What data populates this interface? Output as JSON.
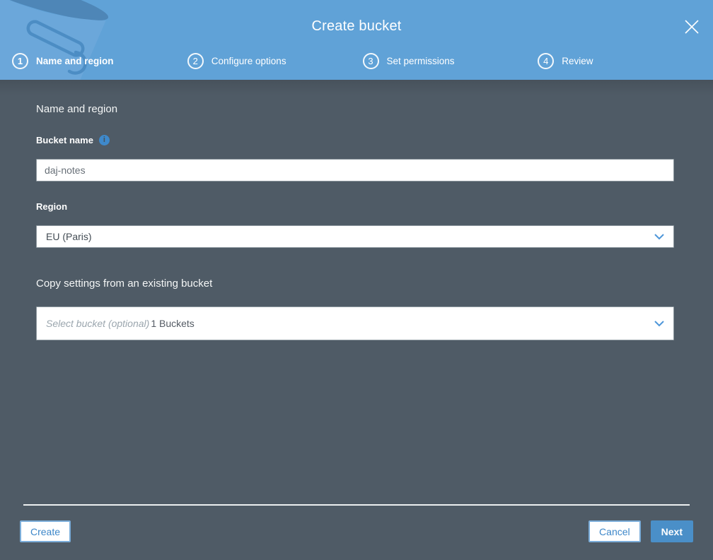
{
  "header": {
    "title": "Create bucket",
    "steps": [
      {
        "number": "1",
        "label": "Name and region"
      },
      {
        "number": "2",
        "label": "Configure options"
      },
      {
        "number": "3",
        "label": "Set permissions"
      },
      {
        "number": "4",
        "label": "Review"
      }
    ]
  },
  "form": {
    "section_heading": "Name and region",
    "bucket_name_label": "Bucket name",
    "bucket_name_value": "daj-notes",
    "region_label": "Region",
    "region_value": "EU (Paris)",
    "copy_heading": "Copy settings from an existing bucket",
    "copy_placeholder": "Select bucket (optional)",
    "copy_count": "1 Buckets",
    "info_icon_glyph": "i"
  },
  "footer": {
    "create": "Create",
    "cancel": "Cancel",
    "next": "Next"
  },
  "icons": {
    "close": "close-icon",
    "info": "info-icon",
    "chevron_down": "chevron-down-icon",
    "watermark": "bucket-icon"
  },
  "colors": {
    "header_blue": "#60a2d7",
    "body_slate": "#4f5b66",
    "accent_blue": "#4a8fc8",
    "link_blue": "#3d87c9"
  }
}
